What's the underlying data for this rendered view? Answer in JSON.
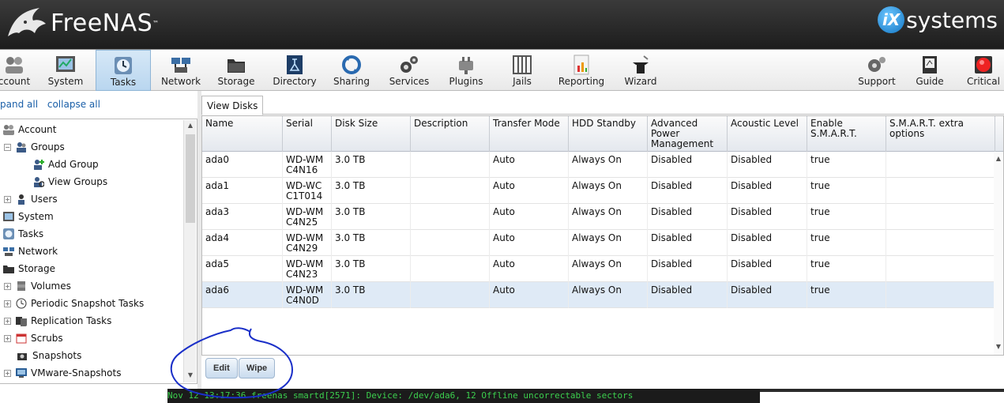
{
  "header": {
    "app_name": "FreeNAS",
    "tm": "™",
    "vendor_badge": "iX",
    "vendor_text": "systems"
  },
  "toolbar": {
    "items": [
      {
        "label": "ccount",
        "icon": "account-icon"
      },
      {
        "label": "System",
        "icon": "system-icon"
      },
      {
        "label": "Tasks",
        "icon": "tasks-icon"
      },
      {
        "label": "Network",
        "icon": "network-icon"
      },
      {
        "label": "Storage",
        "icon": "storage-icon"
      },
      {
        "label": "Directory",
        "icon": "directory-icon"
      },
      {
        "label": "Sharing",
        "icon": "sharing-icon"
      },
      {
        "label": "Services",
        "icon": "services-icon"
      },
      {
        "label": "Plugins",
        "icon": "plugins-icon"
      },
      {
        "label": "Jails",
        "icon": "jails-icon"
      },
      {
        "label": "Reporting",
        "icon": "reporting-icon"
      },
      {
        "label": "Wizard",
        "icon": "wizard-icon"
      },
      {
        "label": "Support",
        "icon": "support-icon"
      },
      {
        "label": "Guide",
        "icon": "guide-icon"
      },
      {
        "label": "Critical",
        "icon": "critical-alert-icon"
      }
    ]
  },
  "tree": {
    "expand_all": "pand all",
    "collapse_all": "collapse all",
    "nodes": [
      {
        "label": "Account"
      },
      {
        "label": "Groups"
      },
      {
        "label": "Add Group"
      },
      {
        "label": "View Groups"
      },
      {
        "label": "Users"
      },
      {
        "label": "System"
      },
      {
        "label": "Tasks"
      },
      {
        "label": "Network"
      },
      {
        "label": "Storage"
      },
      {
        "label": "Volumes"
      },
      {
        "label": "Periodic Snapshot Tasks"
      },
      {
        "label": "Replication Tasks"
      },
      {
        "label": "Scrubs"
      },
      {
        "label": "Snapshots"
      },
      {
        "label": "VMware-Snapshots"
      }
    ]
  },
  "tab": {
    "label": "View Disks"
  },
  "grid": {
    "columns": [
      "Name",
      "Serial",
      "Disk Size",
      "Description",
      "Transfer Mode",
      "HDD Standby",
      "Advanced Power Management",
      "Acoustic Level",
      "Enable S.M.A.R.T.",
      "S.M.A.R.T. extra options"
    ],
    "rows": [
      [
        "ada0",
        "WD-WMC4N16",
        "3.0 TB",
        "",
        "Auto",
        "Always On",
        "Disabled",
        "Disabled",
        "true",
        ""
      ],
      [
        "ada1",
        "WD-WCC1T014",
        "3.0 TB",
        "",
        "Auto",
        "Always On",
        "Disabled",
        "Disabled",
        "true",
        ""
      ],
      [
        "ada3",
        "WD-WMC4N25",
        "3.0 TB",
        "",
        "Auto",
        "Always On",
        "Disabled",
        "Disabled",
        "true",
        ""
      ],
      [
        "ada4",
        "WD-WMC4N29",
        "3.0 TB",
        "",
        "Auto",
        "Always On",
        "Disabled",
        "Disabled",
        "true",
        ""
      ],
      [
        "ada5",
        "WD-WMC4N23",
        "3.0 TB",
        "",
        "Auto",
        "Always On",
        "Disabled",
        "Disabled",
        "true",
        ""
      ],
      [
        "ada6",
        "WD-WMC4N0D",
        "3.0 TB",
        "",
        "Auto",
        "Always On",
        "Disabled",
        "Disabled",
        "true",
        ""
      ]
    ]
  },
  "buttons": {
    "edit": "Edit",
    "wipe": "Wipe"
  },
  "status": {
    "console_text": "Nov 12 13:17:36 freenas smartd[2571]: Device: /dev/ada6, 12 Offline uncorrectable sectors"
  },
  "colors": {
    "accent": "#1276c4",
    "selected_row": "#dfeaf6",
    "console_text": "#3ccf4e",
    "annotation": "#1a2fc8"
  }
}
